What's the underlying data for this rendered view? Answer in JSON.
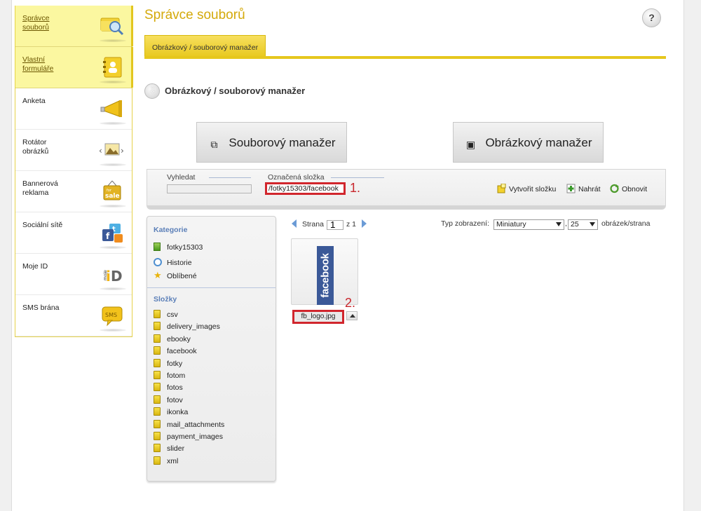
{
  "sidebar": {
    "items": [
      {
        "label": "Správce souborů",
        "icon": "search-files-icon",
        "active": true
      },
      {
        "label": "Vlastní formuláře",
        "icon": "contact-book-icon",
        "active": true
      },
      {
        "label": "Anketa",
        "icon": "megaphone-icon",
        "active": false
      },
      {
        "label": "Rotátor obrázků",
        "icon": "image-rotator-icon",
        "active": false
      },
      {
        "label": "Bannerová reklama",
        "icon": "sale-banner-icon",
        "active": false
      },
      {
        "label": "Sociální sítě",
        "icon": "social-networks-icon",
        "active": false
      },
      {
        "label": "Moje ID",
        "icon": "mojeid-logo-icon",
        "active": false
      },
      {
        "label": "SMS brána",
        "icon": "sms-bubble-icon",
        "active": false
      }
    ]
  },
  "header": {
    "title": "Správce souborů",
    "help": "?",
    "tab": "Obrázkový / souborový manažer"
  },
  "section": {
    "title": "Obrázkový / souborový manažer"
  },
  "buttons": {
    "file_manager": "Souborový manažer",
    "image_manager": "Obrázkový manažer"
  },
  "toolbar": {
    "search_label": "Vyhledat",
    "search_value": "",
    "folder_label": "Označená složka",
    "folder_value": "/fotky15303/facebook",
    "marker1": "1.",
    "create_folder": "Vytvořit složku",
    "upload": "Nahrát",
    "refresh": "Obnovit"
  },
  "panel": {
    "categories_title": "Kategorie",
    "categories": [
      "fotky15303"
    ],
    "history": "Historie",
    "favorites": "Oblíbené",
    "folders_title": "Složky",
    "folders": [
      "csv",
      "delivery_images",
      "ebooky",
      "facebook",
      "fotky",
      "fotom",
      "fotos",
      "fotov",
      "ikonka",
      "mail_attachments",
      "payment_images",
      "slider",
      "xml"
    ]
  },
  "pager": {
    "page_label": "Strana",
    "page_value": "1",
    "of_label": "z 1"
  },
  "view": {
    "label": "Typ zobrazení:",
    "mode": "Miniatury",
    "count": "25",
    "suffix": "obrázek/strana"
  },
  "files": [
    {
      "name": "fb_logo.jpg",
      "thumb_text": "facebook"
    }
  ],
  "marker2": "2.",
  "colors": {
    "accent": "#e6c71d",
    "title": "#d4a90a",
    "highlight_red": "#d1262d",
    "facebook_blue": "#3b5998",
    "sidebar_active": "#fbf7a0"
  }
}
